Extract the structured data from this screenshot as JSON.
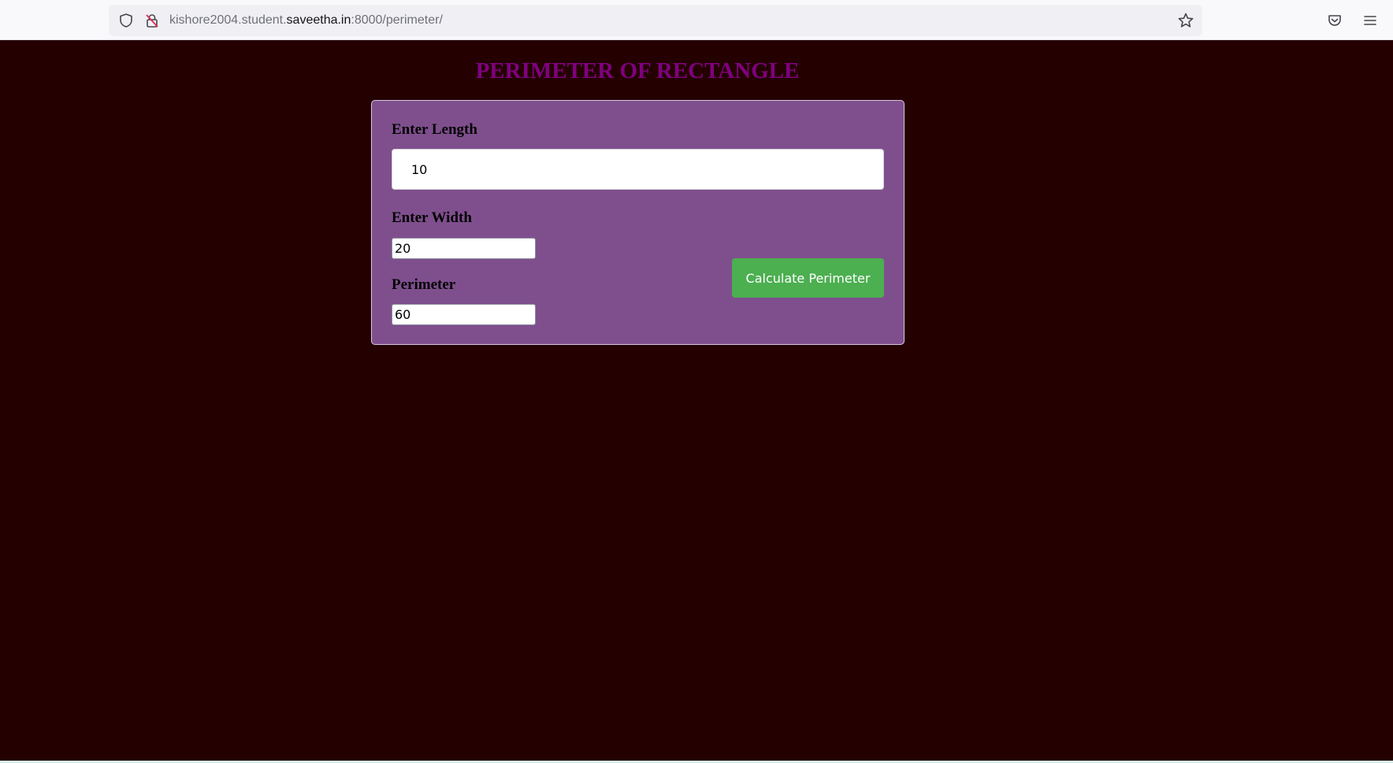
{
  "browser": {
    "url_prefix": "kishore2004.student.",
    "url_domain": "saveetha.in",
    "url_suffix": ":8000/perimeter/"
  },
  "page": {
    "title": "PERIMETER OF RECTANGLE"
  },
  "form": {
    "length_label": "Enter Length",
    "length_value": "10",
    "width_label": "Enter Width",
    "width_value": "20",
    "perimeter_label": "Perimeter",
    "perimeter_value": "60",
    "calculate_label": "Calculate Perimeter"
  },
  "colors": {
    "page_background": "#240000",
    "title": "#800080",
    "card_background": "#7f4f8d",
    "button_background": "#4caf50"
  },
  "icons": {
    "toolbar": [
      "shield-icon",
      "insecure-lock-icon",
      "bookmark-star-icon",
      "pocket-icon",
      "menu-icon"
    ]
  }
}
